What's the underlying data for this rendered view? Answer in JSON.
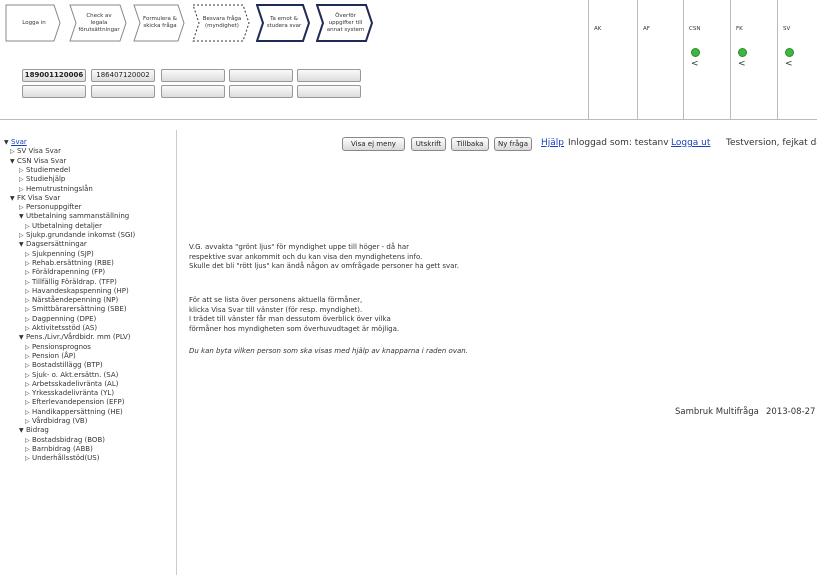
{
  "process_steps": [
    {
      "label": "Logga in"
    },
    {
      "label": "Check av legala förutsättningar"
    },
    {
      "label": "Formulera & skicka fråga"
    },
    {
      "label": "Besvara fråga (myndighet)"
    },
    {
      "label": "Ta emot & studera svar"
    },
    {
      "label": "Överför uppgifter till annat system"
    }
  ],
  "person_buttons": {
    "row1": [
      "189001120006",
      "186407120002",
      "",
      "",
      ""
    ],
    "row2": [
      "",
      "",
      "",
      "",
      ""
    ]
  },
  "agencies": [
    {
      "label": "AK",
      "status": "none",
      "arrow": ""
    },
    {
      "label": "AF",
      "status": "none",
      "arrow": ""
    },
    {
      "label": "CSN",
      "status": "green",
      "arrow": "<"
    },
    {
      "label": "FK",
      "status": "green",
      "arrow": "<"
    },
    {
      "label": "SV",
      "status": "green",
      "arrow": "<"
    }
  ],
  "colors": {
    "green_light": "#3fb73f",
    "link": "#1a3fbf"
  },
  "toolbar": {
    "visa_ej_meny": "Visa ej meny",
    "utskrift": "Utskrift",
    "tillbaka": "Tillbaka",
    "ny_fraga": "Ny fråga",
    "hjalp": "Hjälp",
    "logged_in": "Inloggad som: testanv",
    "logout": "Logga ut",
    "testversion": "Testversion, fejkat data!"
  },
  "tree": [
    {
      "label": "Svar",
      "level": 0,
      "state": "open",
      "link": true
    },
    {
      "label": "SV Visa Svar",
      "level": 1,
      "state": "closed"
    },
    {
      "label": "CSN Visa Svar",
      "level": 1,
      "state": "open"
    },
    {
      "label": "Studiemedel",
      "level": 2,
      "state": "closed"
    },
    {
      "label": "Studiehjälp",
      "level": 2,
      "state": "closed"
    },
    {
      "label": "Hemutrustningslån",
      "level": 2,
      "state": "closed"
    },
    {
      "label": "FK Visa Svar",
      "level": 1,
      "state": "open"
    },
    {
      "label": "Personuppgifter",
      "level": 2,
      "state": "closed"
    },
    {
      "label": "Utbetalning sammanställning",
      "level": 2,
      "state": "open"
    },
    {
      "label": "Utbetalning detaljer",
      "level": 3,
      "state": "closed"
    },
    {
      "label": "Sjukp.grundande inkomst (SGI)",
      "level": 2,
      "state": "closed"
    },
    {
      "label": "Dagsersättningar",
      "level": 2,
      "state": "open"
    },
    {
      "label": "Sjukpenning (SJP)",
      "level": 3,
      "state": "closed"
    },
    {
      "label": "Rehab.ersättning (RBE)",
      "level": 3,
      "state": "closed"
    },
    {
      "label": "Föräldrapenning (FP)",
      "level": 3,
      "state": "closed"
    },
    {
      "label": "Tillfällig Föräldrap. (TFP)",
      "level": 3,
      "state": "closed"
    },
    {
      "label": "Havandeskapspenning (HP)",
      "level": 3,
      "state": "closed"
    },
    {
      "label": "Närståendepenning (NP)",
      "level": 3,
      "state": "closed"
    },
    {
      "label": "Smittbärarersättning (SBE)",
      "level": 3,
      "state": "closed"
    },
    {
      "label": "Dagpenning (DPE)",
      "level": 3,
      "state": "closed"
    },
    {
      "label": "Aktivitetsstöd (AS)",
      "level": 3,
      "state": "closed"
    },
    {
      "label": "Pens./Livr./Vårdbidr. mm (PLV)",
      "level": 2,
      "state": "open"
    },
    {
      "label": "Pensionsprognos",
      "level": 3,
      "state": "closed"
    },
    {
      "label": "Pension (ÅP)",
      "level": 3,
      "state": "closed"
    },
    {
      "label": "Bostadstillägg (BTP)",
      "level": 3,
      "state": "closed"
    },
    {
      "label": "Sjuk- o. Akt.ersättn. (SA)",
      "level": 3,
      "state": "closed"
    },
    {
      "label": "Arbetsskadelivränta (AL)",
      "level": 3,
      "state": "closed"
    },
    {
      "label": "Yrkesskadelivränta (YL)",
      "level": 3,
      "state": "closed"
    },
    {
      "label": "Efterlevandepension (EFP)",
      "level": 3,
      "state": "closed"
    },
    {
      "label": "Handikappersättning (HE)",
      "level": 3,
      "state": "closed"
    },
    {
      "label": "Vårdbidrag (VB)",
      "level": 3,
      "state": "closed"
    },
    {
      "label": "Bidrag",
      "level": 2,
      "state": "open"
    },
    {
      "label": "Bostadsbidrag (BOB)",
      "level": 3,
      "state": "closed"
    },
    {
      "label": "Barnbidrag (ABB)",
      "level": 3,
      "state": "closed"
    },
    {
      "label": "Underhållsstöd(US)",
      "level": 3,
      "state": "closed"
    }
  ],
  "main": {
    "para1": [
      "V.G. avvakta \"grönt ljus\" för myndighet uppe till höger - då har",
      "respektive svar ankommit och du kan visa den myndighetens info.",
      "Skulle det bli \"rött ljus\" kan ändå någon av omfrågade personer ha gett svar."
    ],
    "para2": [
      "För att se lista över personens aktuella förmåner,",
      "klicka Visa Svar till vänster (för resp. myndighet).",
      "I trädet till vänster får man dessutom överblick över vilka",
      "förmåner hos myndigheten som överhuvudtaget är möjliga."
    ],
    "para3": "Du kan byta vilken person som ska visas med hjälp av knapparna i raden ovan.",
    "footer_app": "Sambruk Multifråga",
    "footer_date": "2013-08-27"
  }
}
